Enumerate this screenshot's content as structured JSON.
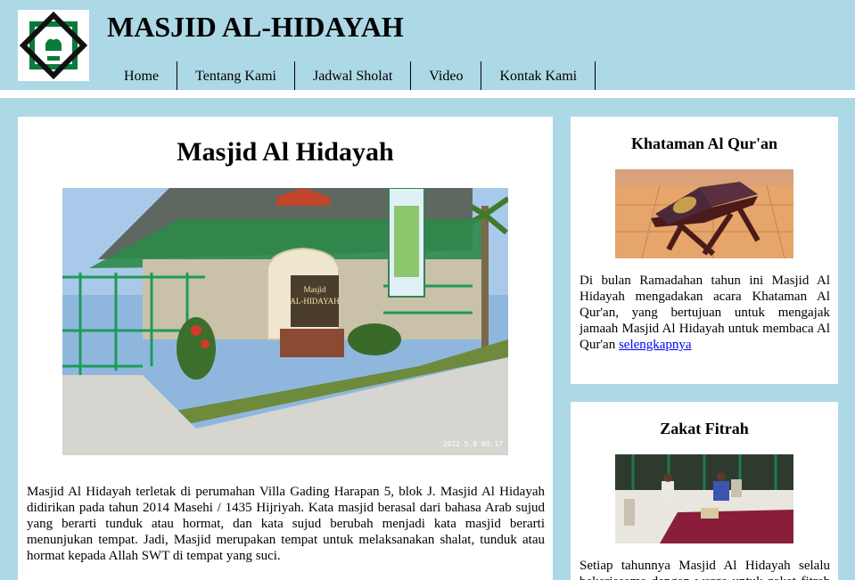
{
  "header": {
    "site_title": "MASJID AL-HIDAYAH",
    "logo_icon": "mosque-logo-icon"
  },
  "nav": {
    "items": [
      {
        "label": "Home"
      },
      {
        "label": "Tentang Kami"
      },
      {
        "label": "Jadwal Sholat"
      },
      {
        "label": "Video"
      },
      {
        "label": "Kontak Kami"
      }
    ]
  },
  "main": {
    "title": "Masjid Al Hidayah",
    "photo_timestamp": "2022.5.8 09:17",
    "sign_line1": "Masjid",
    "sign_line2": "AL-HIDAYAH",
    "paragraph": "Masjid Al Hidayah terletak di perumahan Villa Gading Harapan 5, blok J. Masjid Al Hidayah didirikan pada tahun 2014 Masehi / 1435 Hijriyah. Kata masjid berasal dari bahasa Arab sujud yang berarti tunduk atau hormat, dan kata sujud berubah menjadi kata masjid berarti menunjukan tempat. Jadi, Masjid merupakan tempat untuk melaksanakan shalat, tunduk atau hormat kepada Allah SWT di tempat yang suci."
  },
  "sidebar": {
    "cards": [
      {
        "title": "Khataman Al Qur'an",
        "text": "Di bulan Ramadahan tahun ini Masjid Al Hidayah mengadakan acara Khataman Al Qur'an, yang bertujuan untuk mengajak jamaah Masjid Al Hidayah untuk membaca Al Qur'an ",
        "link_label": "selengkapnya"
      },
      {
        "title": "Zakat Fitrah",
        "text": "Setiap tahunnya Masjid Al Hidayah selalu bekerjasama dengan warga untuk zakat fitrah pada"
      }
    ]
  },
  "colors": {
    "page_background": "#add8e6",
    "panel_background": "#ffffff",
    "link": "#0000ee"
  }
}
